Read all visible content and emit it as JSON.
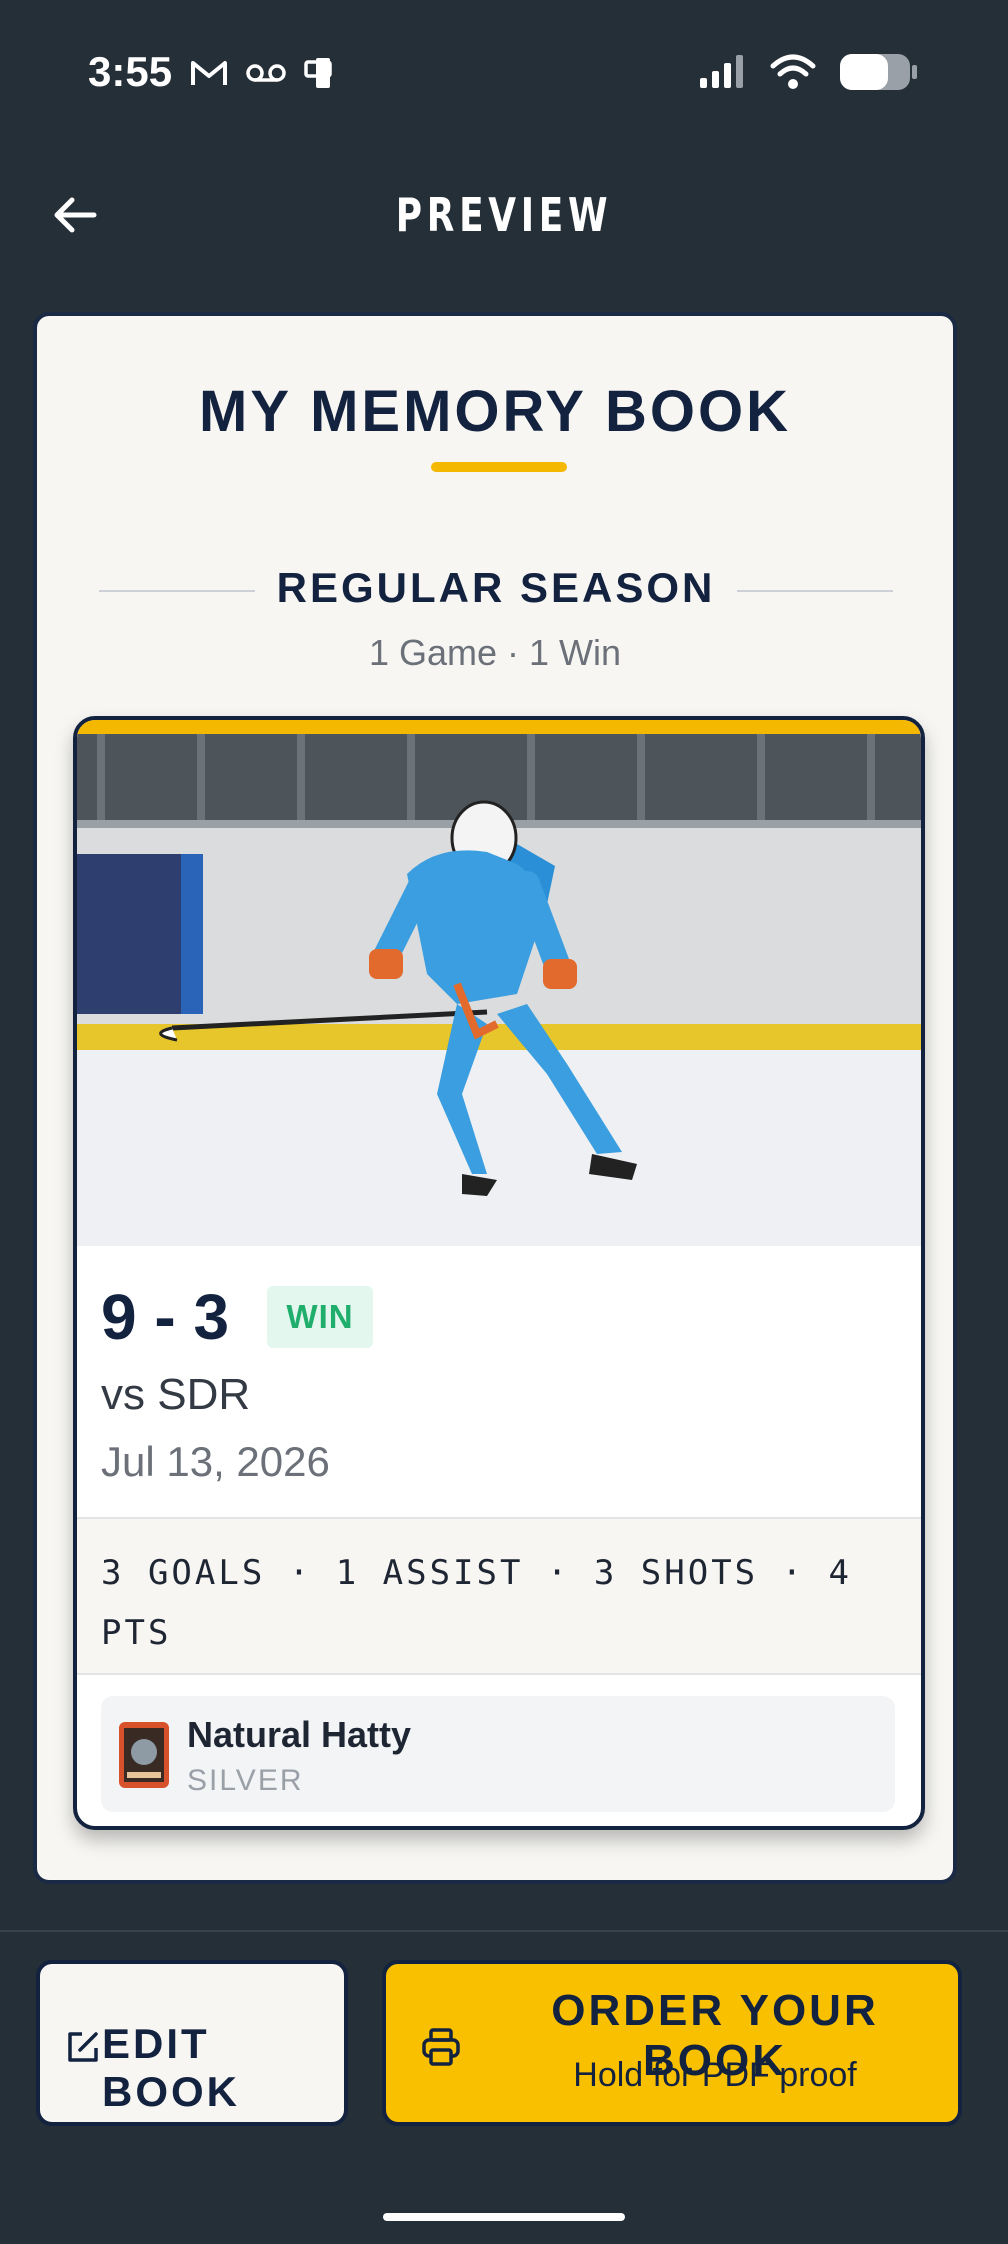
{
  "status_bar": {
    "time": "3:55",
    "left_icons": [
      "gmail-icon",
      "voicemail-icon",
      "device-icon"
    ],
    "right_icons": [
      "signal-icon",
      "wifi-icon",
      "battery-icon"
    ]
  },
  "header": {
    "title": "PREVIEW",
    "back_icon": "arrow-left-icon"
  },
  "book": {
    "title": "MY MEMORY BOOK",
    "section": {
      "label": "REGULAR SEASON",
      "summary": "1 Game · 1 Win"
    },
    "game": {
      "score": "9 - 3",
      "result": "WIN",
      "opponent": "vs SDR",
      "date": "Jul 13, 2026",
      "stats": "3 GOALS · 1 ASSIST · 3 SHOTS · 4 PTS",
      "award": {
        "name": "Natural Hatty",
        "tier": "SILVER"
      }
    }
  },
  "actions": {
    "edit_label": "EDIT BOOK",
    "order_label": "ORDER YOUR BOOK",
    "order_sub": "Hold for PDF proof"
  },
  "colors": {
    "background": "#252f38",
    "accent": "#f9c000",
    "navy": "#12223f",
    "win_green": "#1fae6b"
  }
}
